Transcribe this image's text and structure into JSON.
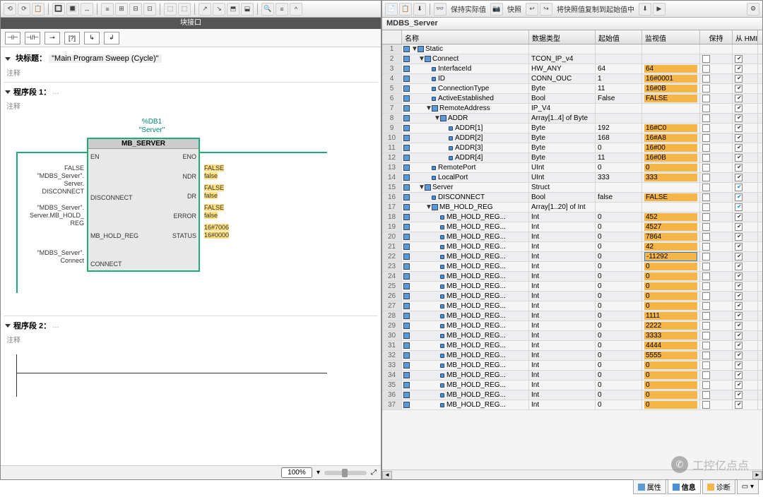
{
  "left": {
    "interfaceTitle": "块接口",
    "blockTitleLabel": "块标题：",
    "blockTitle": "\"Main Program Sweep (Cycle)\"",
    "comment": "注释",
    "seg1": "程序段 1：",
    "seg2": "程序段 2：",
    "dots": "...",
    "dbLabel": "%DB1",
    "dbName": "\"Server\"",
    "fbName": "MB_SERVER",
    "pins": {
      "en": "EN",
      "eno": "ENO",
      "ndr": "NDR",
      "dr": "DR",
      "error": "ERROR",
      "status": "STATUS",
      "disconnect": "DISCONNECT",
      "hold": "MB_HOLD_REG",
      "connect": "CONNECT"
    },
    "ext": {
      "disc": "FALSE\n\"MDBS_Server\".\nServer.\nDISCONNECT",
      "hold": "\"MDBS_Server\".\nServer.MB_HOLD_\nREG",
      "conn": "\"MDBS_Server\".\nConnect",
      "ndr": "FALSE\nfalse",
      "dr": "FALSE\nfalse",
      "err": "FALSE\nfalse",
      "status": "16#7006\n16#0000"
    },
    "zoom": "100%"
  },
  "right": {
    "toolbar": {
      "keepActual": "保持实际值",
      "snapshot": "快照",
      "copyStart": "将快照值复制到起始值中"
    },
    "title": "MDBS_Server",
    "cols": {
      "name": "名称",
      "type": "数据类型",
      "start": "起始值",
      "mon": "监视值",
      "keep": "保持",
      "hmi": "从 HMI/OP..."
    }
  },
  "rows": [
    {
      "i": 1,
      "lvl": 0,
      "exp": "▼",
      "ico": "s",
      "name": "Static",
      "type": "",
      "start": "",
      "mon": "",
      "keep": "",
      "hmi": ""
    },
    {
      "i": 2,
      "lvl": 1,
      "exp": "▼",
      "ico": "s",
      "name": "Connect",
      "type": "TCON_IP_v4",
      "start": "",
      "mon": "",
      "keep": "cb",
      "hmi": "cbc"
    },
    {
      "i": 3,
      "lvl": 2,
      "exp": "",
      "ico": "v",
      "name": "InterfaceId",
      "type": "HW_ANY",
      "start": "64",
      "mon": "64",
      "monhl": true,
      "keep": "cb",
      "hmi": "cbc"
    },
    {
      "i": 4,
      "lvl": 2,
      "exp": "",
      "ico": "v",
      "name": "ID",
      "type": "CONN_OUC",
      "start": "1",
      "mon": "16#0001",
      "monhl": true,
      "keep": "cb",
      "hmi": "cbc"
    },
    {
      "i": 5,
      "lvl": 2,
      "exp": "",
      "ico": "v",
      "name": "ConnectionType",
      "type": "Byte",
      "start": "11",
      "mon": "16#0B",
      "monhl": true,
      "keep": "cb",
      "hmi": "cbc"
    },
    {
      "i": 6,
      "lvl": 2,
      "exp": "",
      "ico": "v",
      "name": "ActiveEstablished",
      "type": "Bool",
      "start": "False",
      "mon": "FALSE",
      "monhl": true,
      "keep": "cb",
      "hmi": "cbc"
    },
    {
      "i": 7,
      "lvl": 2,
      "exp": "▼",
      "ico": "s",
      "name": "RemoteAddress",
      "type": "IP_V4",
      "start": "",
      "mon": "",
      "keep": "cb",
      "hmi": "cbc"
    },
    {
      "i": 8,
      "lvl": 3,
      "exp": "▼",
      "ico": "s",
      "name": "ADDR",
      "type": "Array[1..4] of Byte",
      "start": "",
      "mon": "",
      "keep": "cb",
      "hmi": "cbc"
    },
    {
      "i": 9,
      "lvl": 4,
      "exp": "",
      "ico": "v",
      "name": "ADDR[1]",
      "type": "Byte",
      "start": "192",
      "mon": "16#C0",
      "monhl": true,
      "keep": "cb",
      "hmi": "cbc"
    },
    {
      "i": 10,
      "lvl": 4,
      "exp": "",
      "ico": "v",
      "name": "ADDR[2]",
      "type": "Byte",
      "start": "168",
      "mon": "16#A8",
      "monhl": true,
      "keep": "cb",
      "hmi": "cbc"
    },
    {
      "i": 11,
      "lvl": 4,
      "exp": "",
      "ico": "v",
      "name": "ADDR[3]",
      "type": "Byte",
      "start": "0",
      "mon": "16#00",
      "monhl": true,
      "keep": "cb",
      "hmi": "cbc"
    },
    {
      "i": 12,
      "lvl": 4,
      "exp": "",
      "ico": "v",
      "name": "ADDR[4]",
      "type": "Byte",
      "start": "11",
      "mon": "16#0B",
      "monhl": true,
      "keep": "cb",
      "hmi": "cbc"
    },
    {
      "i": 13,
      "lvl": 2,
      "exp": "",
      "ico": "v",
      "name": "RemotePort",
      "type": "UInt",
      "start": "0",
      "mon": "0",
      "monhl": true,
      "keep": "cb",
      "hmi": "cbc"
    },
    {
      "i": 14,
      "lvl": 2,
      "exp": "",
      "ico": "v",
      "name": "LocalPort",
      "type": "UInt",
      "start": "333",
      "mon": "333",
      "monhl": true,
      "keep": "cb",
      "hmi": "cbc"
    },
    {
      "i": 15,
      "lvl": 1,
      "exp": "▼",
      "ico": "s",
      "name": "Server",
      "type": "Struct",
      "start": "",
      "mon": "",
      "keep": "cb",
      "hmi": "cbcb"
    },
    {
      "i": 16,
      "lvl": 2,
      "exp": "",
      "ico": "v",
      "name": "DISCONNECT",
      "type": "Bool",
      "start": "false",
      "mon": "FALSE",
      "monhl": true,
      "keep": "cb",
      "hmi": "cbcb"
    },
    {
      "i": 17,
      "lvl": 2,
      "exp": "▼",
      "ico": "s",
      "name": "MB_HOLD_REG",
      "type": "Array[1..20] of Int",
      "start": "",
      "mon": "",
      "keep": "cb",
      "hmi": "cbcb"
    },
    {
      "i": 18,
      "lvl": 3,
      "exp": "",
      "ico": "v",
      "name": "MB_HOLD_REG...",
      "type": "Int",
      "start": "0",
      "mon": "452",
      "monhl": true,
      "keep": "cb",
      "hmi": "cbc"
    },
    {
      "i": 19,
      "lvl": 3,
      "exp": "",
      "ico": "v",
      "name": "MB_HOLD_REG...",
      "type": "Int",
      "start": "0",
      "mon": "4527",
      "monhl": true,
      "keep": "cb",
      "hmi": "cbc"
    },
    {
      "i": 20,
      "lvl": 3,
      "exp": "",
      "ico": "v",
      "name": "MB_HOLD_REG...",
      "type": "Int",
      "start": "0",
      "mon": "7864",
      "monhl": true,
      "keep": "cb",
      "hmi": "cbc"
    },
    {
      "i": 21,
      "lvl": 3,
      "exp": "",
      "ico": "v",
      "name": "MB_HOLD_REG...",
      "type": "Int",
      "start": "0",
      "mon": "42",
      "monhl": true,
      "keep": "cb",
      "hmi": "cbc"
    },
    {
      "i": 22,
      "lvl": 3,
      "exp": "",
      "ico": "v",
      "name": "MB_HOLD_REG...",
      "type": "Int",
      "start": "0",
      "mon": "-11292",
      "monhl": true,
      "sel": true,
      "keep": "cb",
      "hmi": "cbc"
    },
    {
      "i": 23,
      "lvl": 3,
      "exp": "",
      "ico": "v",
      "name": "MB_HOLD_REG...",
      "type": "Int",
      "start": "0",
      "mon": "0",
      "monhl": true,
      "keep": "cb",
      "hmi": "cbc"
    },
    {
      "i": 24,
      "lvl": 3,
      "exp": "",
      "ico": "v",
      "name": "MB_HOLD_REG...",
      "type": "Int",
      "start": "0",
      "mon": "0",
      "monhl": true,
      "keep": "cb",
      "hmi": "cbc"
    },
    {
      "i": 25,
      "lvl": 3,
      "exp": "",
      "ico": "v",
      "name": "MB_HOLD_REG...",
      "type": "Int",
      "start": "0",
      "mon": "0",
      "monhl": true,
      "keep": "cb",
      "hmi": "cbc"
    },
    {
      "i": 26,
      "lvl": 3,
      "exp": "",
      "ico": "v",
      "name": "MB_HOLD_REG...",
      "type": "Int",
      "start": "0",
      "mon": "0",
      "monhl": true,
      "keep": "cb",
      "hmi": "cbc"
    },
    {
      "i": 27,
      "lvl": 3,
      "exp": "",
      "ico": "v",
      "name": "MB_HOLD_REG...",
      "type": "Int",
      "start": "0",
      "mon": "0",
      "monhl": true,
      "keep": "cb",
      "hmi": "cbc"
    },
    {
      "i": 28,
      "lvl": 3,
      "exp": "",
      "ico": "v",
      "name": "MB_HOLD_REG...",
      "type": "Int",
      "start": "0",
      "mon": "1111",
      "monhl": true,
      "keep": "cb",
      "hmi": "cbc"
    },
    {
      "i": 29,
      "lvl": 3,
      "exp": "",
      "ico": "v",
      "name": "MB_HOLD_REG...",
      "type": "Int",
      "start": "0",
      "mon": "2222",
      "monhl": true,
      "keep": "cb",
      "hmi": "cbc"
    },
    {
      "i": 30,
      "lvl": 3,
      "exp": "",
      "ico": "v",
      "name": "MB_HOLD_REG...",
      "type": "Int",
      "start": "0",
      "mon": "3333",
      "monhl": true,
      "keep": "cb",
      "hmi": "cbc"
    },
    {
      "i": 31,
      "lvl": 3,
      "exp": "",
      "ico": "v",
      "name": "MB_HOLD_REG...",
      "type": "Int",
      "start": "0",
      "mon": "4444",
      "monhl": true,
      "keep": "cb",
      "hmi": "cbc"
    },
    {
      "i": 32,
      "lvl": 3,
      "exp": "",
      "ico": "v",
      "name": "MB_HOLD_REG...",
      "type": "Int",
      "start": "0",
      "mon": "5555",
      "monhl": true,
      "keep": "cb",
      "hmi": "cbc"
    },
    {
      "i": 33,
      "lvl": 3,
      "exp": "",
      "ico": "v",
      "name": "MB_HOLD_REG...",
      "type": "Int",
      "start": "0",
      "mon": "0",
      "monhl": true,
      "keep": "cb",
      "hmi": "cbc"
    },
    {
      "i": 34,
      "lvl": 3,
      "exp": "",
      "ico": "v",
      "name": "MB_HOLD_REG...",
      "type": "Int",
      "start": "0",
      "mon": "0",
      "monhl": true,
      "keep": "cb",
      "hmi": "cbc"
    },
    {
      "i": 35,
      "lvl": 3,
      "exp": "",
      "ico": "v",
      "name": "MB_HOLD_REG...",
      "type": "Int",
      "start": "0",
      "mon": "0",
      "monhl": true,
      "keep": "cb",
      "hmi": "cbc"
    },
    {
      "i": 36,
      "lvl": 3,
      "exp": "",
      "ico": "v",
      "name": "MB_HOLD_REG...",
      "type": "Int",
      "start": "0",
      "mon": "0",
      "monhl": true,
      "keep": "cb",
      "hmi": "cbc"
    },
    {
      "i": 37,
      "lvl": 3,
      "exp": "",
      "ico": "v",
      "name": "MB_HOLD_REG...",
      "type": "Int",
      "start": "0",
      "mon": "0",
      "monhl": true,
      "keep": "cb",
      "hmi": "cbc"
    }
  ],
  "status": {
    "props": "属性",
    "info": "信息",
    "diag": "诊断"
  },
  "watermark": "工控亿点点"
}
